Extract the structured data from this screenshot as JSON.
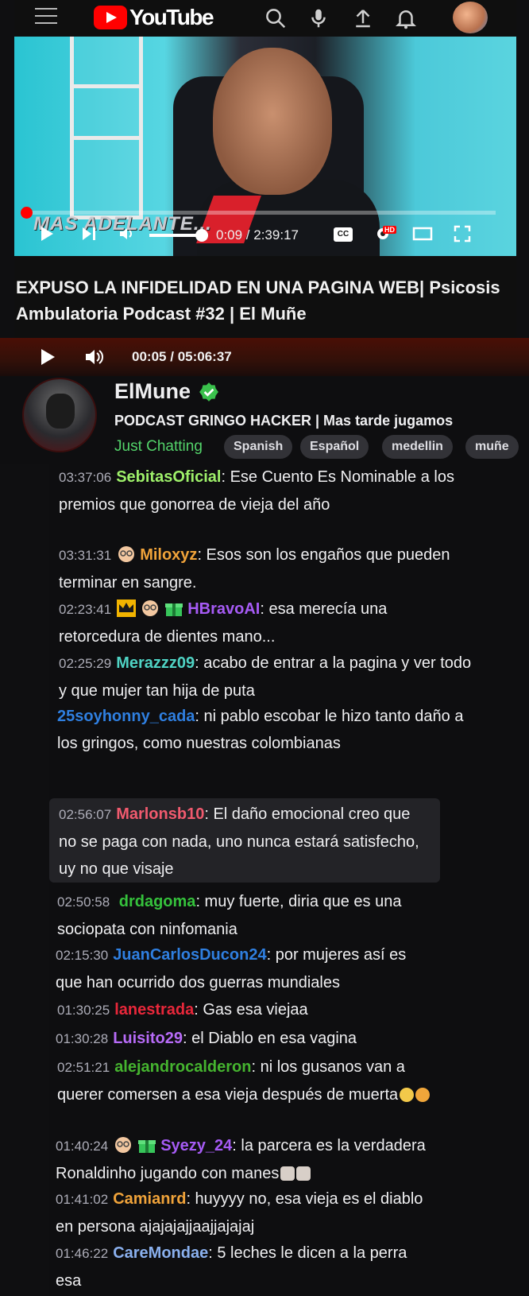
{
  "youtube": {
    "logo_text": "YouTube",
    "overlay_text": "MAS ADELANTE...",
    "player_time": "0:09 / 2:39:17",
    "progress_fraction": 0.004,
    "cc_label": "CC",
    "hd_label": "HD",
    "video_title": "EXPUSO LA INFIDELIDAD EN UNA PAGINA WEB| Psicosis Ambulatoria Podcast #32 | El Muñe"
  },
  "player": {
    "time": "00:05",
    "separator": "/",
    "duration": "05:06:37"
  },
  "channel": {
    "name": "ElMune",
    "stream_title": "PODCAST GRINGO HACKER | Mas tarde jugamos",
    "category": "Just Chatting",
    "tags": [
      "Spanish",
      "Español",
      "medellin",
      "muñe"
    ]
  },
  "chat": {
    "messages": [
      {
        "time": "03:37:06",
        "user": "SebitasOficial",
        "color": "#9ef06a",
        "text": ": Ese Cuento Es Nominable a los premios que gonorrea de vieja del año"
      },
      {
        "time": "03:31:31",
        "user": "Miloxyz",
        "color": "#f0a33a",
        "text": ": Esos son los engaños que pueden terminar en sangre."
      },
      {
        "time": "02:23:41",
        "user": "HBravoAI",
        "color": "#a65bf5",
        "text": ": esa merecía una retorcedura de dientes mano..."
      },
      {
        "time": "02:25:29",
        "user": "Merazzz09",
        "color": "#4fd3c4",
        "text": ": acabo de entrar a la pagina y ver todo y que mujer tan hija de puta"
      },
      {
        "time": "",
        "user": "25soyhonny_cada",
        "color": "#2f7fe0",
        "text": ": ni pablo escobar le hizo tanto daño a los gringos, como nuestras colombianas"
      },
      {
        "time": "02:56:07",
        "user": "Marlonsb10",
        "color": "#f05a6e",
        "text": ": El daño emocional creo que no se paga con nada, uno nunca estará satisfecho, uy no que visaje"
      },
      {
        "time": "02:50:58",
        "user": "drdagoma",
        "color": "#35c23c",
        "text": ": muy fuerte, diria que es una sociopata con ninfomania"
      },
      {
        "time": "02:15:30",
        "user": "JuanCarlosDucon24",
        "color": "#2f7fe0",
        "text": ": por mujeres así es que han ocurrido dos guerras mundiales"
      },
      {
        "time": "01:30:25",
        "user": "lanestrada",
        "color": "#e8273a",
        "text": ": Gas esa viejaa"
      },
      {
        "time": "01:30:28",
        "user": "Luisito29",
        "color": "#b76bf7",
        "text": ": el Diablo en esa vagina"
      },
      {
        "time": "02:51:21",
        "user": "alejandrocalderon",
        "color": "#45b42f",
        "text": ": ni los gusanos van a querer comersen a esa vieja después de muerta"
      },
      {
        "time": "01:40:24",
        "user": "Syezy_24",
        "color": "#a65bf5",
        "text": ": la parcera es la verdadera Ronaldinho jugando con manes"
      },
      {
        "time": "01:41:02",
        "user": "Camianrd",
        "color": "#f0a33a",
        "text": ": huyyyy no, esa vieja es el diablo en persona ajajajajjaajjajajaj"
      },
      {
        "time": "01:46:22",
        "user": "CareMondae",
        "color": "#8ab0ee",
        "text": ": 5 leches le dicen a la perra esa"
      }
    ]
  },
  "icons": {
    "menu": "menu-icon",
    "search": "search-icon",
    "mic": "mic-icon",
    "upload": "upload-icon",
    "bell": "bell-icon",
    "play": "play-icon",
    "next": "next-icon",
    "volume": "volume-icon",
    "settings": "gear-icon",
    "theater": "theater-icon",
    "fullscreen": "fullscreen-icon",
    "verified": "verified-icon",
    "crown": "crown-badge-icon",
    "gift": "gift-badge-icon",
    "face": "face-badge-icon"
  }
}
